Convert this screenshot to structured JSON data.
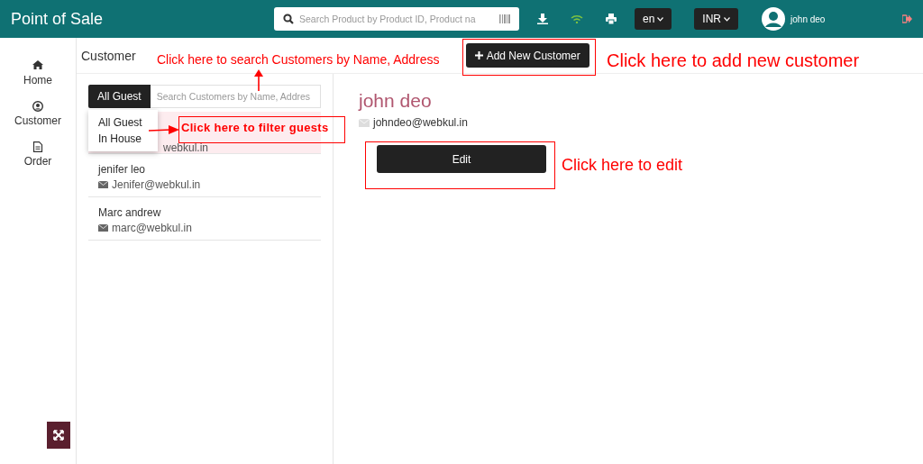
{
  "topbar": {
    "title": "Point of Sale",
    "search_placeholder": "Search Product by Product ID, Product na",
    "language": "en",
    "currency": "INR",
    "user": "john deo"
  },
  "sidebar": {
    "items": [
      {
        "label": "Home"
      },
      {
        "label": "Customer"
      },
      {
        "label": "Order"
      }
    ]
  },
  "page_title": "Customer",
  "add_button": "Add New Customer",
  "filter": {
    "selected_label": "All Guest",
    "placeholder": "Search Customers by Name, Addres",
    "options": [
      "All Guest",
      "In House"
    ]
  },
  "customers": [
    {
      "email": "webkul.in",
      "selected": true
    },
    {
      "name": "jenifer leo",
      "email": "Jenifer@webkul.in",
      "selected": false
    },
    {
      "name": "Marc andrew",
      "email": "marc@webkul.in",
      "selected": false
    }
  ],
  "detail": {
    "name": "john deo",
    "email": "johndeo@webkul.in",
    "edit_button": "Edit"
  },
  "annotations": {
    "search": "Click here to search Customers by Name, Address",
    "filter": "Click here to filter guests",
    "add": "Click here to add new customer",
    "edit": "Click here to edit"
  }
}
